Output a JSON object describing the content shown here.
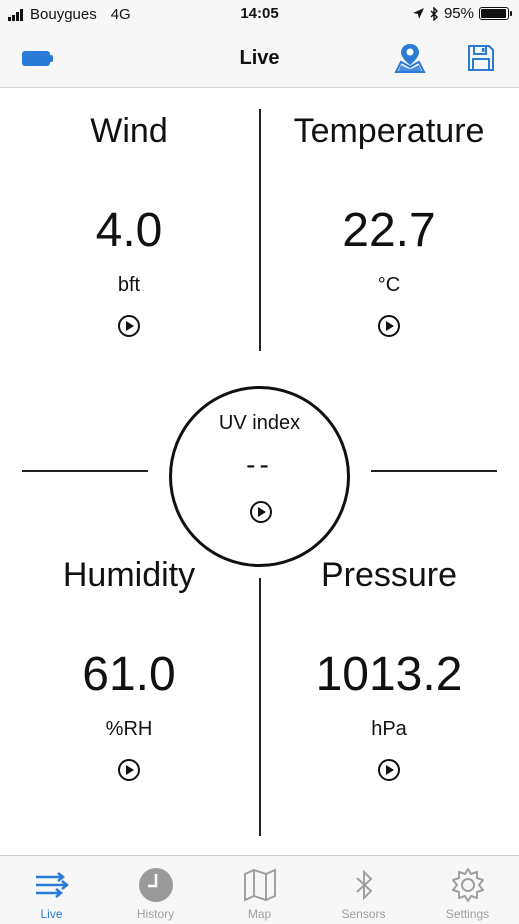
{
  "status_bar": {
    "carrier": "Bouygues",
    "network": "4G",
    "time": "14:05",
    "battery": "95%",
    "battery_level": 0.95
  },
  "nav": {
    "title": "Live"
  },
  "tiles": {
    "wind": {
      "label": "Wind",
      "value": "4.0",
      "unit": "bft"
    },
    "temperature": {
      "label": "Temperature",
      "value": "22.7",
      "unit": "°C"
    },
    "humidity": {
      "label": "Humidity",
      "value": "61.0",
      "unit": "%RH"
    },
    "pressure": {
      "label": "Pressure",
      "value": "1013.2",
      "unit": "hPa"
    }
  },
  "uv": {
    "label": "UV index",
    "value": "--"
  },
  "tabs": [
    {
      "label": "Live",
      "icon": "wind-lines-icon",
      "active": true
    },
    {
      "label": "History",
      "icon": "clock-icon",
      "active": false
    },
    {
      "label": "Map",
      "icon": "map-icon",
      "active": false
    },
    {
      "label": "Sensors",
      "icon": "bluetooth-icon",
      "active": false
    },
    {
      "label": "Settings",
      "icon": "gear-icon",
      "active": false
    }
  ],
  "colors": {
    "accent": "#2a7ad8",
    "inactive": "#a0a0a0",
    "bar_background": "#f7f7f7"
  }
}
